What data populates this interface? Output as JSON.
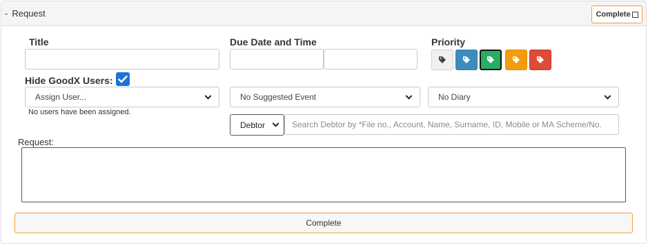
{
  "header": {
    "collapse_sign": "-",
    "title": "Request",
    "complete_toggle_label": "Complete"
  },
  "form": {
    "title_label": "Title",
    "title_value": "",
    "due_label": "Due Date and Time",
    "due_date_value": "",
    "due_time_value": "",
    "priority_label": "Priority",
    "priority_levels": [
      {
        "color": "#f0f0f0",
        "icon": "tag-icon"
      },
      {
        "color": "#3c8dbc",
        "icon": "tag-icon"
      },
      {
        "color": "#27ae60",
        "icon": "tag-icon",
        "selected": true
      },
      {
        "color": "#f39c12",
        "icon": "tag-icon"
      },
      {
        "color": "#dd4b39",
        "icon": "tag-icon"
      }
    ],
    "hide_users_label": "Hide GoodX Users:",
    "hide_users_checked": true,
    "assign_user": "Assign User...",
    "no_users_text": "No users have been assigned.",
    "suggested_event": "No Suggested Event",
    "diary": "No Diary",
    "debtor_select": "Debtor",
    "debtor_search_placeholder": "Search Debtor by *File no., Account, Name, Surname, ID, Mobile or MA Scheme/No.",
    "request_label": "Request:",
    "request_value": "",
    "complete_button": "Complete"
  },
  "colors": {
    "accent_orange": "#f0a030",
    "checkbox_blue": "#1e73d6"
  }
}
